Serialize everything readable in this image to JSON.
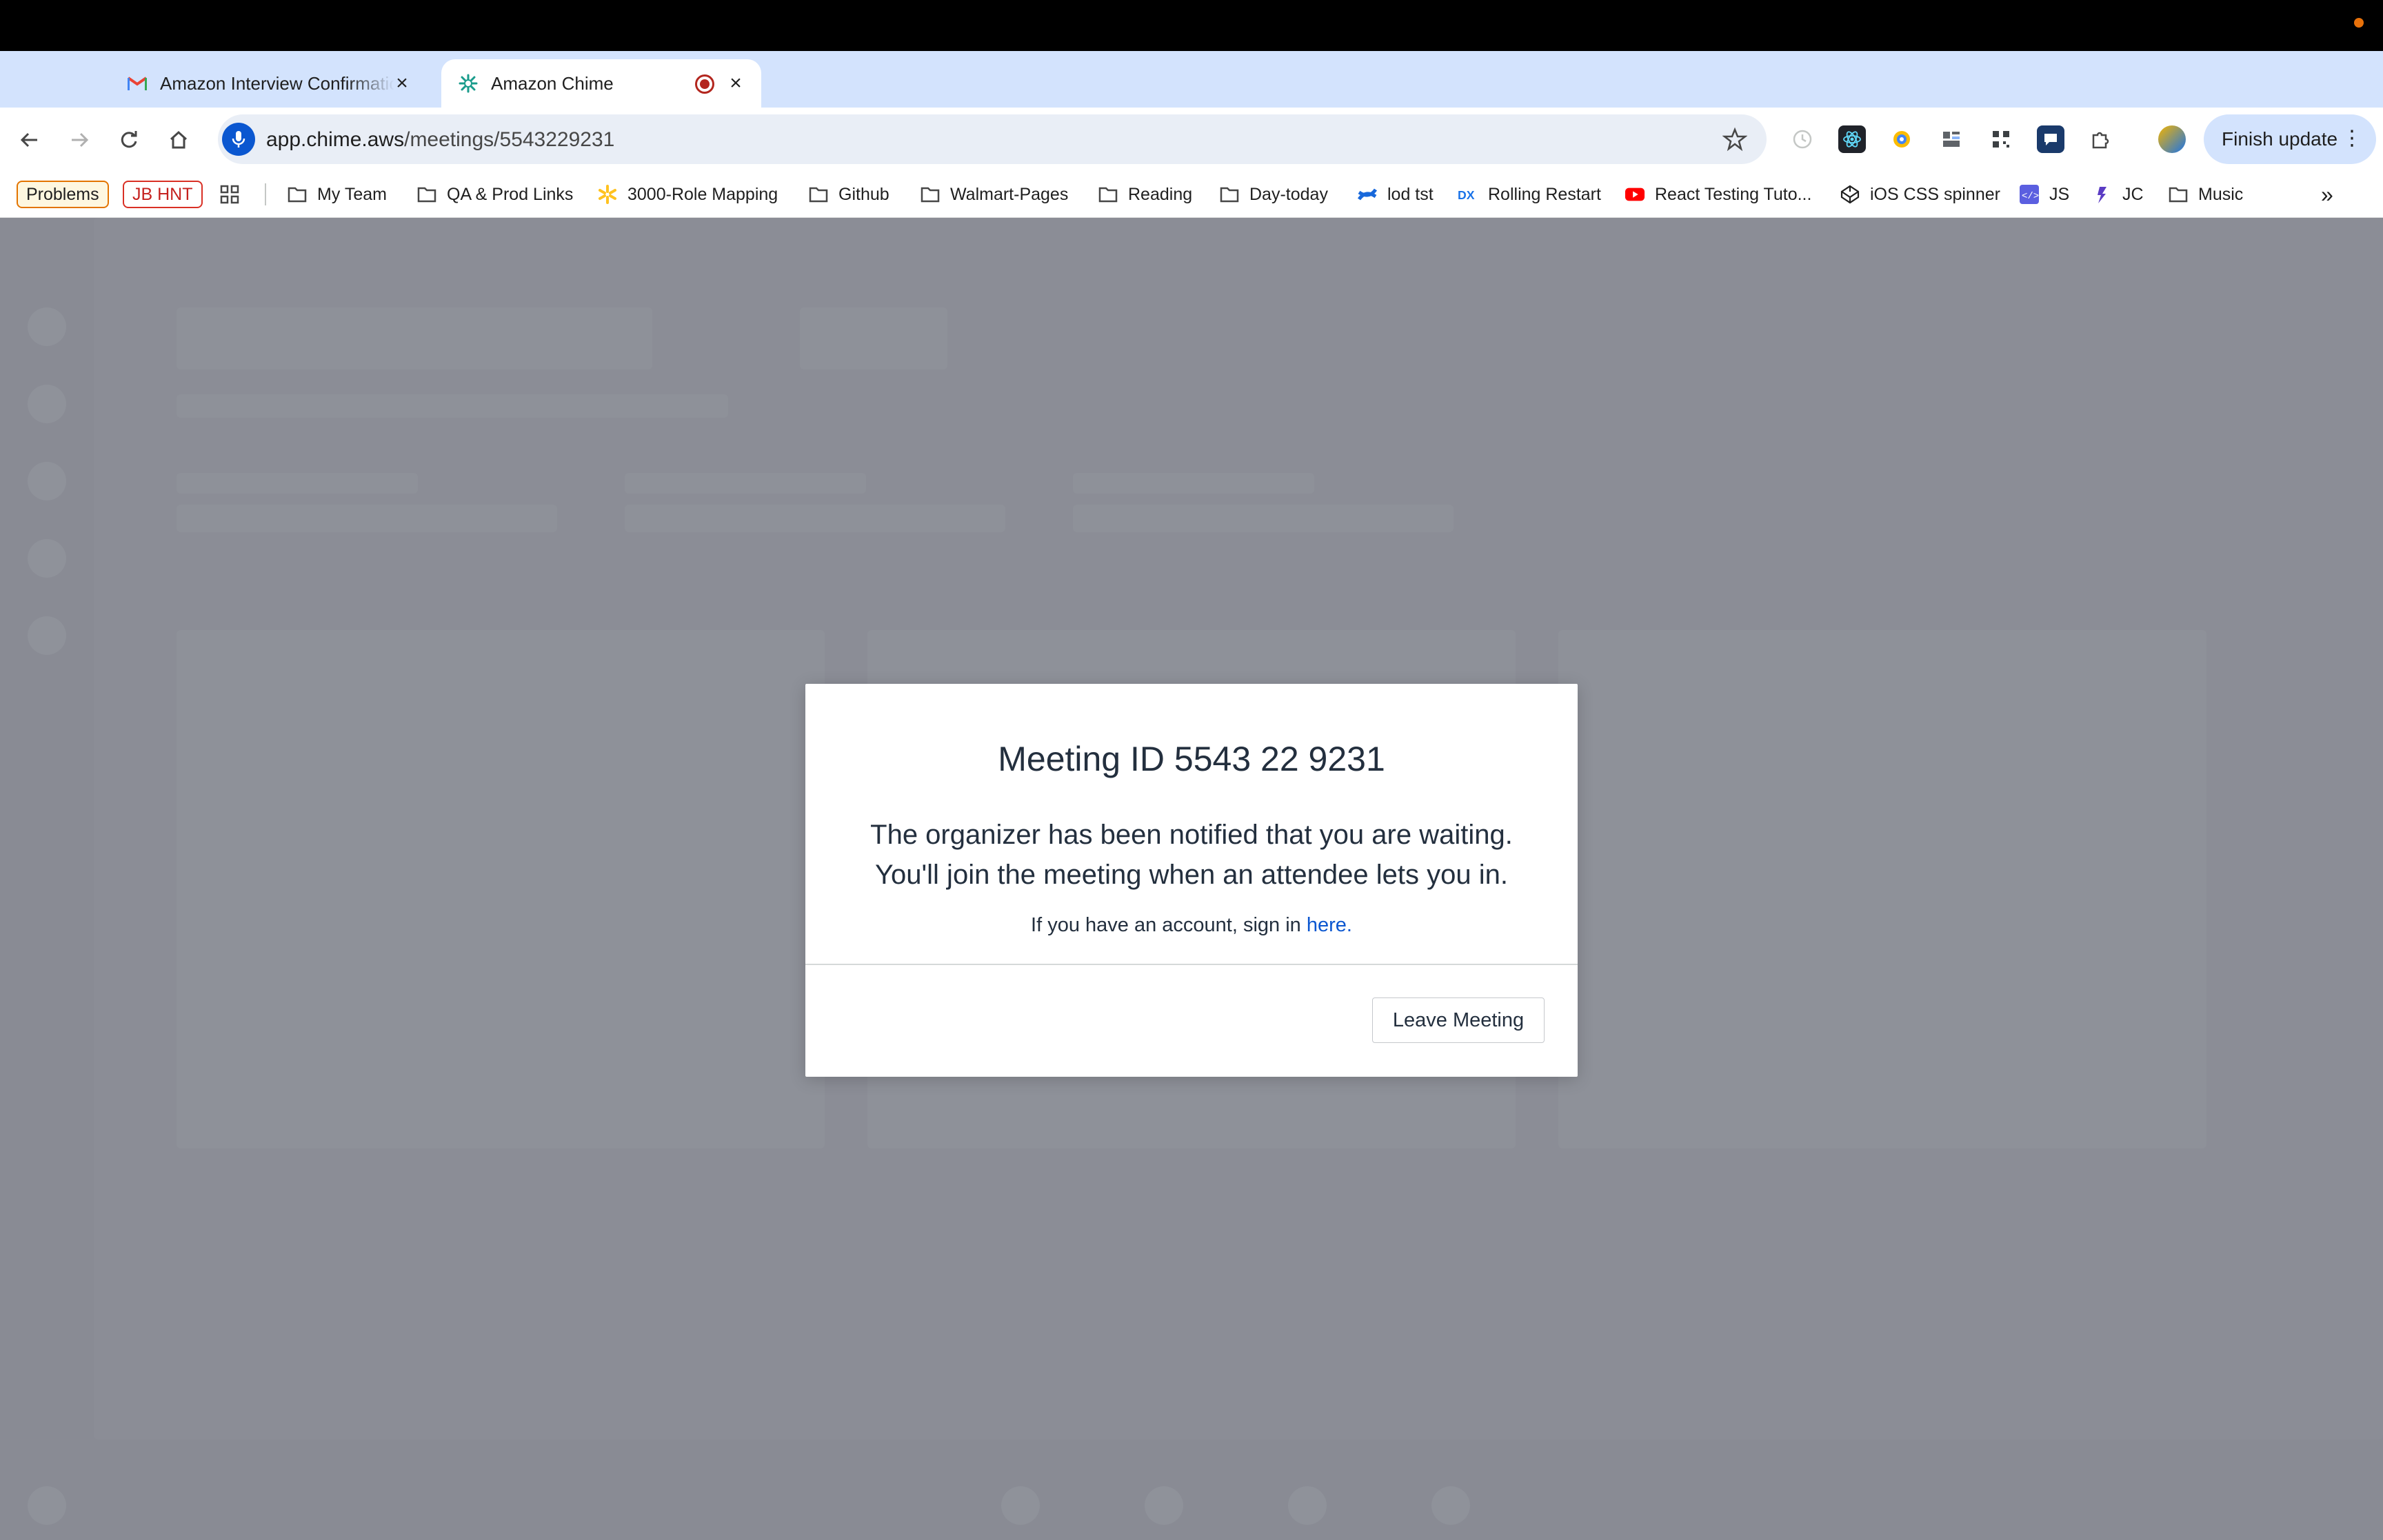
{
  "browser": {
    "tabs": [
      {
        "title": "Amazon Interview Confirmation",
        "favicon": "gmail-icon",
        "active": false
      },
      {
        "title": "Amazon Chime",
        "favicon": "chime-icon",
        "active": true,
        "recording": true
      }
    ],
    "address_bar": {
      "host": "app.chime.aws",
      "path": "/meetings/5543229231"
    },
    "update_button": "Finish update",
    "bookmarks": [
      {
        "label": "Problems",
        "type": "pill"
      },
      {
        "label": "JB HNT",
        "type": "pill"
      },
      {
        "label": "My Team",
        "icon": "folder-icon"
      },
      {
        "label": "QA & Prod Links",
        "icon": "folder-icon"
      },
      {
        "label": "3000-Role Mapping",
        "icon": "walmart-spark-icon"
      },
      {
        "label": "Github",
        "icon": "folder-icon"
      },
      {
        "label": "Walmart-Pages",
        "icon": "folder-icon"
      },
      {
        "label": "Reading",
        "icon": "folder-icon"
      },
      {
        "label": "Day-today",
        "icon": "folder-icon"
      },
      {
        "label": "lod tst",
        "icon": "confluence-icon"
      },
      {
        "label": "Rolling Restart",
        "icon": "dx-icon"
      },
      {
        "label": "React Testing Tuto...",
        "icon": "youtube-icon"
      },
      {
        "label": "iOS CSS spinner",
        "icon": "codepen-icon"
      },
      {
        "label": "JS",
        "icon": "code-icon"
      },
      {
        "label": "JC",
        "icon": "jc-icon"
      },
      {
        "label": "Music",
        "icon": "folder-icon"
      }
    ]
  },
  "modal": {
    "title": "Meeting ID 5543 22 9231",
    "message_line1": "The organizer has been notified that you are waiting.",
    "message_line2": "You'll join the meeting when an attendee lets you in.",
    "signin_prefix": "If you have an account, sign in ",
    "signin_link": "here.",
    "leave_button": "Leave Meeting"
  },
  "colors": {
    "tabstrip": "#d3e3fd",
    "overlay": "#898b94",
    "link": "#0b57d0",
    "recording": "#b3261e"
  }
}
